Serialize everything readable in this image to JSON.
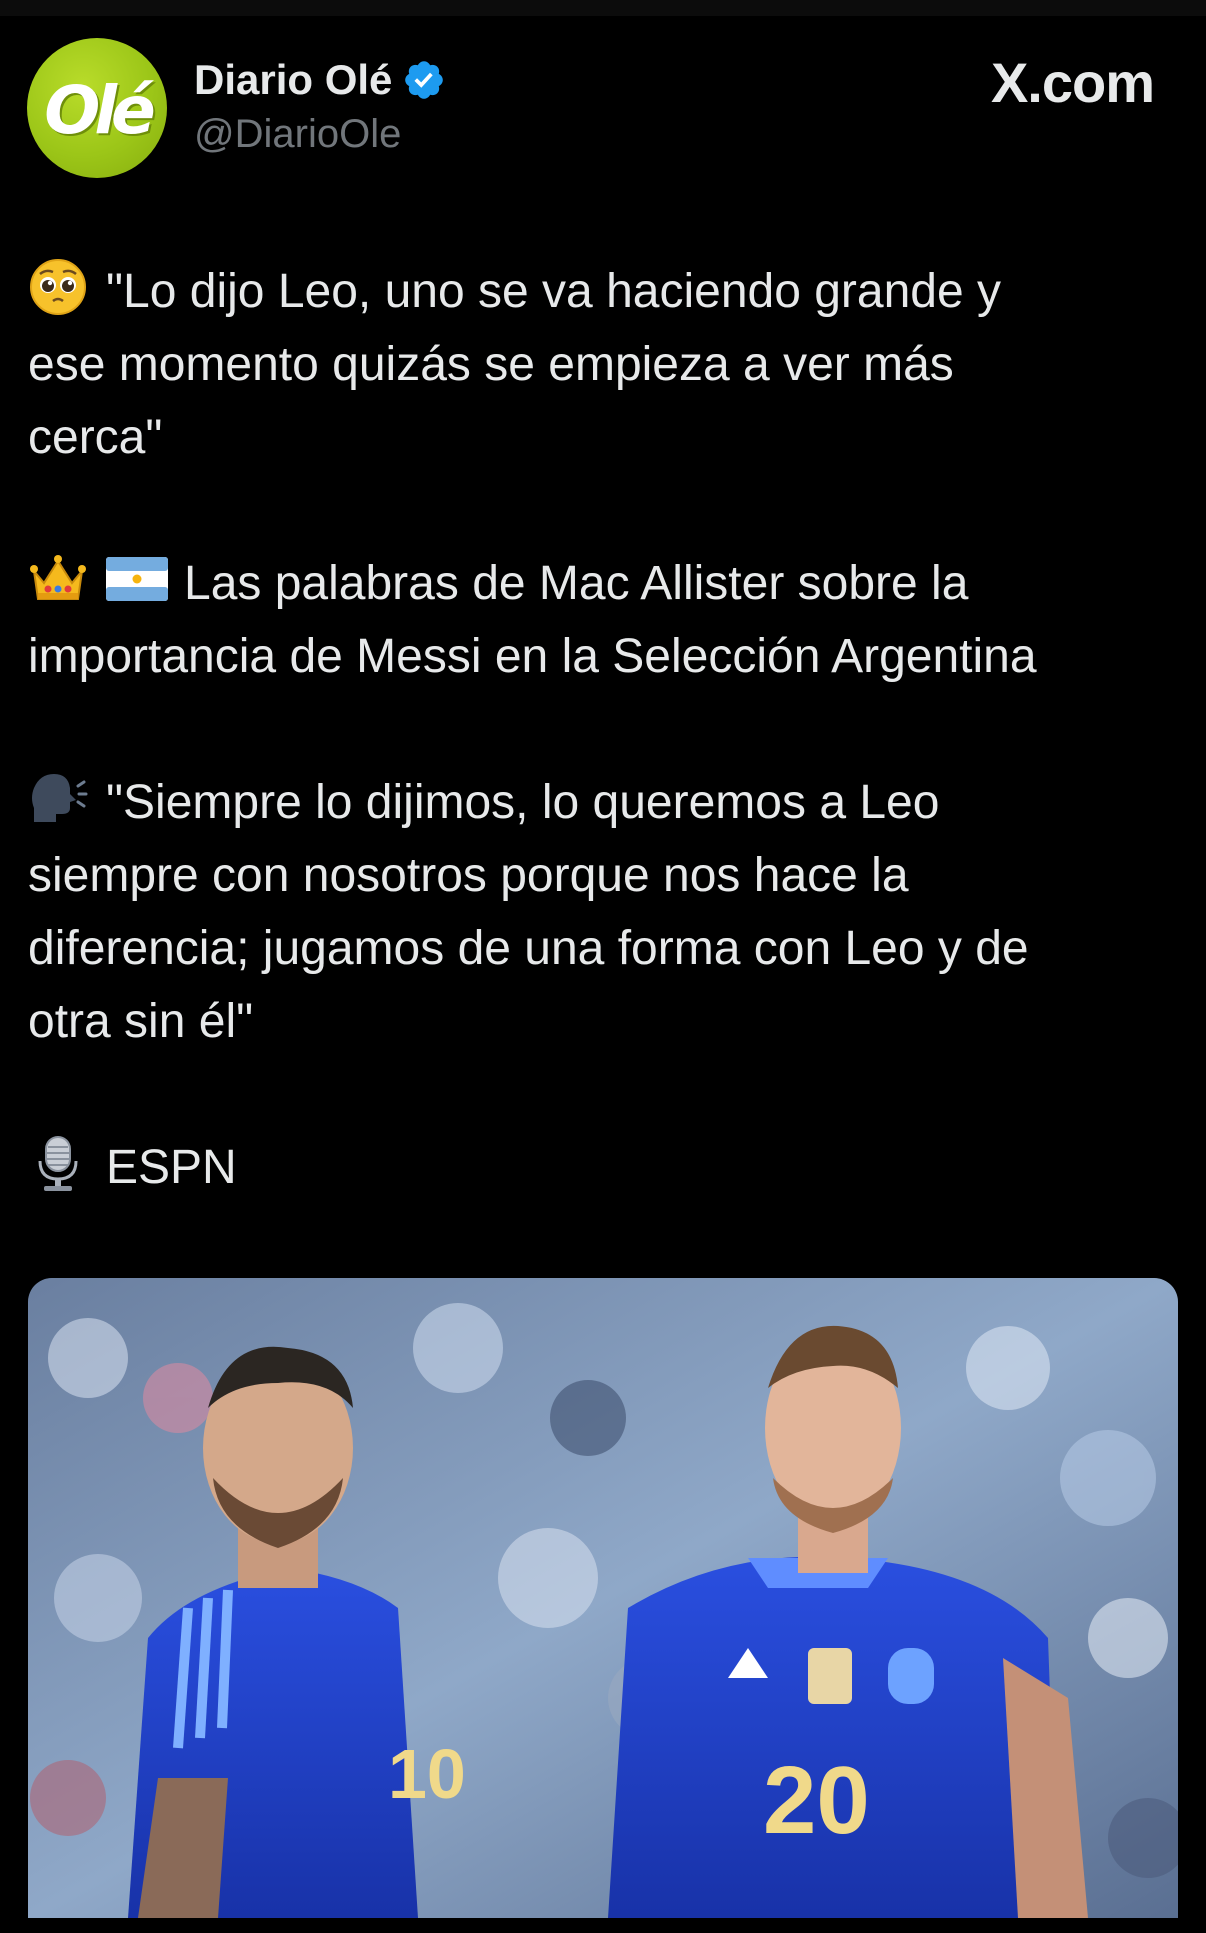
{
  "account": {
    "display_name": "Diario Olé",
    "handle": "@DiarioOle",
    "avatar_text": "Olé",
    "verified": true
  },
  "site_label": "X.com",
  "tweet": {
    "paragraphs": [
      {
        "emoji": "pleading-face",
        "lines": [
          "\"Lo dijo Leo, uno se va haciendo grande y",
          "ese momento quizás se empieza a ver más",
          "cerca\""
        ]
      },
      {
        "emoji": "crown + argentina-flag",
        "lines": [
          "Las palabras de Mac Allister sobre la",
          "importancia de Messi en la Selección Argentina"
        ]
      },
      {
        "emoji": "speaking-head",
        "lines": [
          "\"Siempre lo dijimos, lo queremos a Leo",
          "siempre con nosotros porque nos hace la",
          "diferencia; jugamos de una forma con Leo y de",
          "otra sin él\""
        ]
      },
      {
        "emoji": "studio-microphone",
        "lines": [
          "ESPN"
        ]
      }
    ]
  },
  "media": {
    "left_player_number": "10",
    "right_player_number": "20"
  },
  "colors": {
    "background": "#000000",
    "text": "#e7e9ea",
    "secondary_text": "#71767b",
    "verified_blue": "#1d9bf0",
    "avatar_green": "#9cc618",
    "jersey_blue": "#1f3fc4"
  }
}
